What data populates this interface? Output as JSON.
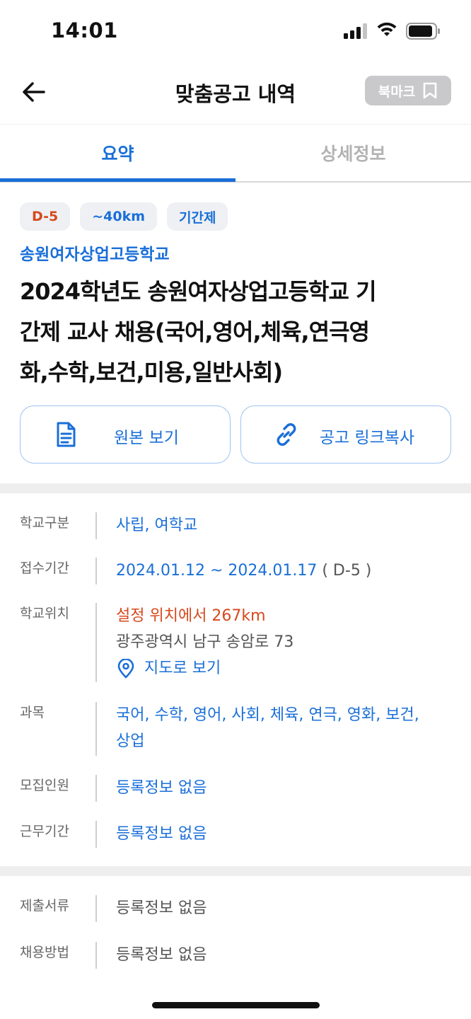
{
  "status_bar": {
    "time": "14:01"
  },
  "nav": {
    "title": "맞춤공고 내역",
    "bookmark_label": "북마크"
  },
  "tabs": [
    {
      "label": "요약",
      "active": true
    },
    {
      "label": "상세정보",
      "active": false
    }
  ],
  "chips": [
    {
      "label": "D-5",
      "color": "#d6491c"
    },
    {
      "label": "~40km",
      "color": "#1a6fd8"
    },
    {
      "label": "기간제",
      "color": "#1a6fd8"
    }
  ],
  "school_name": "송원여자상업고등학교",
  "post_title_lines": [
    "2024학년도 송원여자상업고등학교 기",
    "간제 교사 채용(국어,영어,체육,연극영",
    "화,수학,보건,미용,일반사회)"
  ],
  "actions": {
    "view_original": "원본 보기",
    "copy_link": "공고 링크복사"
  },
  "info": {
    "school_type": {
      "label": "학교구분",
      "value": "사립, 여학교"
    },
    "application_period": {
      "label": "접수기간",
      "value": "2024.01.12 ~ 2024.01.17",
      "dday": "( D-5 )"
    },
    "location": {
      "label": "학교위치",
      "distance": "설정 위치에서 267km",
      "address": "광주광역시 남구 송암로 73",
      "map_link": "지도로 보기"
    },
    "subjects": {
      "label": "과목",
      "value_lines": [
        "국어, 수학, 영어, 사회, 체육, 연극, 영화, 보건,",
        "상업"
      ]
    },
    "recruits": {
      "label": "모집인원",
      "value": "등록정보 없음"
    },
    "work_period": {
      "label": "근무기간",
      "value": "등록정보 없음"
    }
  },
  "info2": {
    "documents": {
      "label": "제출서류",
      "value": "등록정보 없음"
    },
    "hiring_method": {
      "label": "채용방법",
      "value": "등록정보 없음"
    }
  },
  "colors": {
    "accent": "#1a6fd8",
    "warning": "#d6491c",
    "bookmark_bg": "#c9c9cc"
  }
}
